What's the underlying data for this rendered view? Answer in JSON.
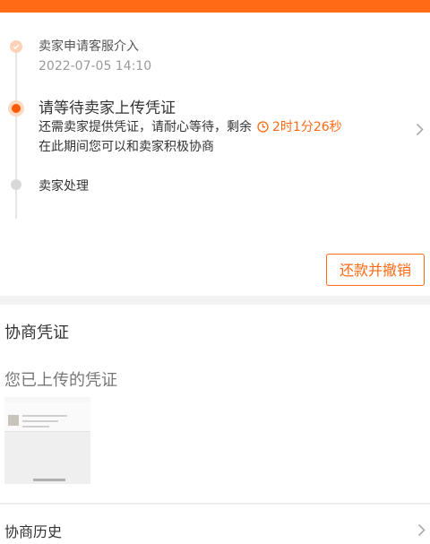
{
  "colors": {
    "accent": "#ff6a14",
    "gap": "#f2f2f2"
  },
  "timeline": {
    "steps": [
      {
        "title": "卖家申请客服介入",
        "time": "2022-07-05 14:10",
        "state": "done",
        "icon": "check-icon"
      },
      {
        "title": "请等待卖家上传凭证",
        "line1": "还需卖家提供凭证，请耐心等待，剩余",
        "countdown": "2时1分26秒",
        "line2": "在此期间您可以和卖家积极协商",
        "state": "active",
        "icon": "clock-icon"
      },
      {
        "title": "卖家处理",
        "state": "pending"
      }
    ]
  },
  "actions": {
    "refund_revoke": "还款并撤销"
  },
  "evidence": {
    "title": "协商凭证",
    "uploaded_label": "您已上传的凭证"
  },
  "history": {
    "title": "协商历史"
  }
}
